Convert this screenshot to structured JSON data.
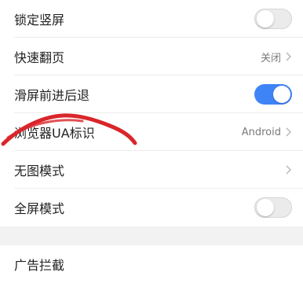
{
  "settings": {
    "lock_portrait": {
      "label": "锁定竖屏",
      "enabled": false
    },
    "quick_page_turn": {
      "label": "快速翻页",
      "value": "关闭"
    },
    "swipe_nav": {
      "label": "滑屏前进后退",
      "enabled": true
    },
    "browser_ua": {
      "label": "浏览器UA标识",
      "value": "Android"
    },
    "no_image_mode": {
      "label": "无图模式"
    },
    "fullscreen_mode": {
      "label": "全屏模式",
      "enabled": false
    },
    "next_item": {
      "label": "广告拦截"
    }
  },
  "colors": {
    "toggle_on": "#3f84f6",
    "toggle_off": "#ebebeb",
    "annotation": "#d9262a",
    "section_gap": "#f2f2f2"
  }
}
